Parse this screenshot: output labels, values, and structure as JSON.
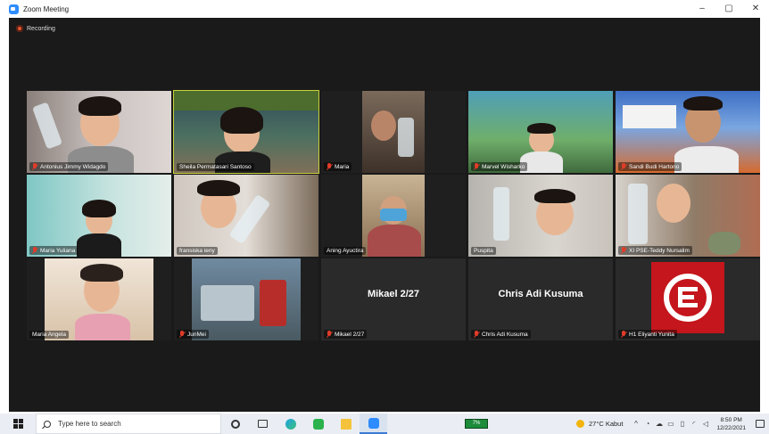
{
  "window": {
    "title": "Zoom Meeting",
    "controls": [
      "–",
      "▢",
      "✕"
    ]
  },
  "recording": {
    "label": "Recording"
  },
  "participants": [
    {
      "name": "Antonius Jimmy Widagdo",
      "muted": true,
      "video": true
    },
    {
      "name": "Sheila Permatasari Santoso",
      "muted": false,
      "video": true,
      "active": true
    },
    {
      "name": "Maria",
      "muted": true,
      "video": true
    },
    {
      "name": "Marvel Wisharko",
      "muted": true,
      "video": true
    },
    {
      "name": "Sandi Budi Hartono",
      "muted": true,
      "video": true
    },
    {
      "name": "Maria Yuliana",
      "muted": true,
      "video": true
    },
    {
      "name": "fransiska ieny",
      "muted": false,
      "video": true
    },
    {
      "name": "Aning Ayuctira",
      "muted": false,
      "video": true
    },
    {
      "name": "Puspita",
      "muted": false,
      "video": true
    },
    {
      "name": "XI PSE-Teddy Nursalim",
      "muted": true,
      "video": true
    },
    {
      "name": "Maria Angela",
      "muted": false,
      "video": true
    },
    {
      "name": "JunMei",
      "muted": true,
      "video": true
    },
    {
      "name": "Mikael 2/27",
      "muted": true,
      "video": false,
      "display_name": "Mikael 2/27"
    },
    {
      "name": "Chris Adi Kusuma",
      "muted": true,
      "video": false,
      "display_name": "Chris Adi Kusuma"
    },
    {
      "name": "H1 Eliyanti Yunita",
      "muted": true,
      "video": false,
      "avatar": "E-logo"
    }
  ],
  "taskbar": {
    "search_placeholder": "Type here to search",
    "weather": "27°C Kabut",
    "battery": "7%",
    "time": "8:50 PM",
    "date": "12/22/2021"
  }
}
